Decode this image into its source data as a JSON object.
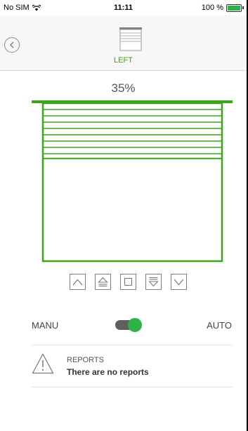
{
  "status_bar": {
    "carrier": "No SIM",
    "time": "11:11",
    "battery": "100 %"
  },
  "header": {
    "device_label": "LEFT"
  },
  "shutter": {
    "position_text": "35%",
    "closed_fraction": 0.35
  },
  "controls": {
    "icons": [
      "chevron-up-icon",
      "step-up-icon",
      "stop-icon",
      "step-down-icon",
      "chevron-down-icon"
    ]
  },
  "mode": {
    "left_label": "MANU",
    "right_label": "AUTO",
    "auto_enabled": true
  },
  "reports": {
    "title": "REPORTS",
    "message": "There are no reports"
  },
  "colors": {
    "accent": "#3aa516",
    "toggle_on": "#2db34a"
  }
}
